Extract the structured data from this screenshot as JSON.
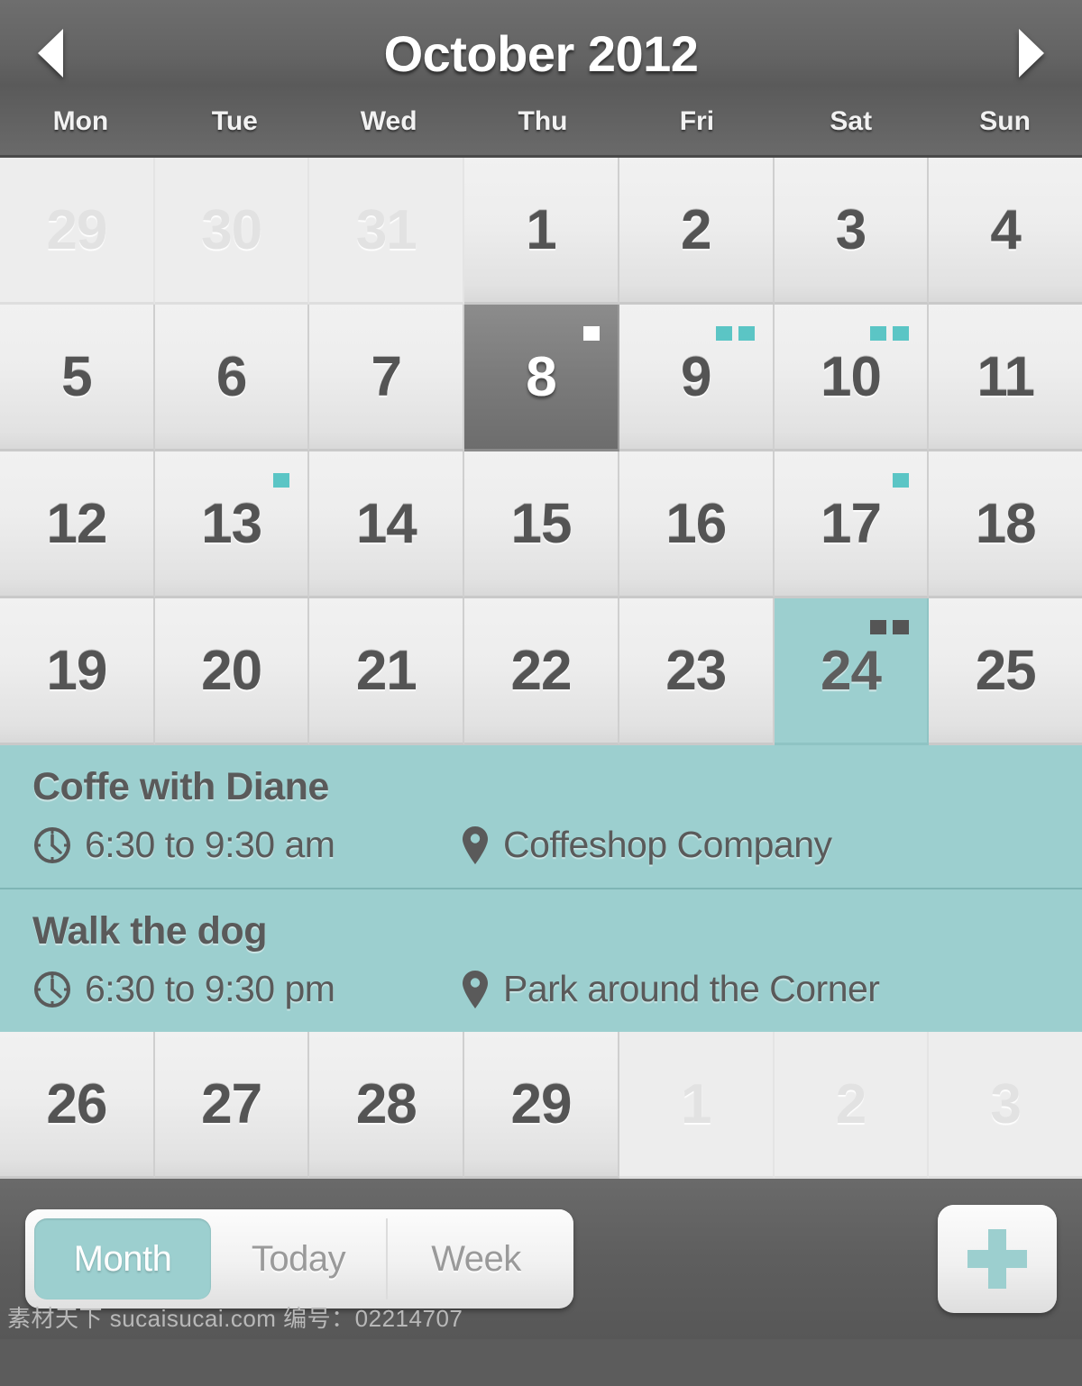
{
  "header": {
    "title": "October 2012",
    "prev_icon": "triangle-left-icon",
    "next_icon": "triangle-right-icon",
    "weekdays": [
      "Mon",
      "Tue",
      "Wed",
      "Thu",
      "Fri",
      "Sat",
      "Sun"
    ]
  },
  "colors": {
    "accent_teal": "#9ccfcf",
    "dot_teal": "#5bc5c5",
    "today_gray": "#7b7b7b",
    "toolbar_gray": "#5e5e5e",
    "cell_light": "#ededed",
    "text_dark": "#545454"
  },
  "calendar": {
    "weeks": [
      [
        {
          "day": "29",
          "outside": true,
          "today": false,
          "selected": false,
          "dots": 0
        },
        {
          "day": "30",
          "outside": true,
          "today": false,
          "selected": false,
          "dots": 0
        },
        {
          "day": "31",
          "outside": true,
          "today": false,
          "selected": false,
          "dots": 0
        },
        {
          "day": "1",
          "outside": false,
          "today": false,
          "selected": false,
          "dots": 0
        },
        {
          "day": "2",
          "outside": false,
          "today": false,
          "selected": false,
          "dots": 0
        },
        {
          "day": "3",
          "outside": false,
          "today": false,
          "selected": false,
          "dots": 0
        },
        {
          "day": "4",
          "outside": false,
          "today": false,
          "selected": false,
          "dots": 0
        }
      ],
      [
        {
          "day": "5",
          "outside": false,
          "today": false,
          "selected": false,
          "dots": 0
        },
        {
          "day": "6",
          "outside": false,
          "today": false,
          "selected": false,
          "dots": 0
        },
        {
          "day": "7",
          "outside": false,
          "today": false,
          "selected": false,
          "dots": 0
        },
        {
          "day": "8",
          "outside": false,
          "today": true,
          "selected": false,
          "dots": 1
        },
        {
          "day": "9",
          "outside": false,
          "today": false,
          "selected": false,
          "dots": 2
        },
        {
          "day": "10",
          "outside": false,
          "today": false,
          "selected": false,
          "dots": 2
        },
        {
          "day": "11",
          "outside": false,
          "today": false,
          "selected": false,
          "dots": 0
        }
      ],
      [
        {
          "day": "12",
          "outside": false,
          "today": false,
          "selected": false,
          "dots": 0
        },
        {
          "day": "13",
          "outside": false,
          "today": false,
          "selected": false,
          "dots": 1
        },
        {
          "day": "14",
          "outside": false,
          "today": false,
          "selected": false,
          "dots": 0
        },
        {
          "day": "15",
          "outside": false,
          "today": false,
          "selected": false,
          "dots": 0
        },
        {
          "day": "16",
          "outside": false,
          "today": false,
          "selected": false,
          "dots": 0
        },
        {
          "day": "17",
          "outside": false,
          "today": false,
          "selected": false,
          "dots": 1
        },
        {
          "day": "18",
          "outside": false,
          "today": false,
          "selected": false,
          "dots": 0
        }
      ],
      [
        {
          "day": "19",
          "outside": false,
          "today": false,
          "selected": false,
          "dots": 0
        },
        {
          "day": "20",
          "outside": false,
          "today": false,
          "selected": false,
          "dots": 0
        },
        {
          "day": "21",
          "outside": false,
          "today": false,
          "selected": false,
          "dots": 0
        },
        {
          "day": "22",
          "outside": false,
          "today": false,
          "selected": false,
          "dots": 0
        },
        {
          "day": "23",
          "outside": false,
          "today": false,
          "selected": false,
          "dots": 0
        },
        {
          "day": "24",
          "outside": false,
          "today": false,
          "selected": true,
          "dots": 2
        },
        {
          "day": "25",
          "outside": false,
          "today": false,
          "selected": false,
          "dots": 0
        }
      ],
      [
        {
          "day": "26",
          "outside": false,
          "today": false,
          "selected": false,
          "dots": 0
        },
        {
          "day": "27",
          "outside": false,
          "today": false,
          "selected": false,
          "dots": 0
        },
        {
          "day": "28",
          "outside": false,
          "today": false,
          "selected": false,
          "dots": 0
        },
        {
          "day": "29",
          "outside": false,
          "today": false,
          "selected": false,
          "dots": 0
        },
        {
          "day": "1",
          "outside": true,
          "today": false,
          "selected": false,
          "dots": 0
        },
        {
          "day": "2",
          "outside": true,
          "today": false,
          "selected": false,
          "dots": 0
        },
        {
          "day": "3",
          "outside": true,
          "today": false,
          "selected": false,
          "dots": 0
        }
      ]
    ]
  },
  "events": [
    {
      "title": "Coffe with Diane",
      "time": "6:30 to 9:30 am",
      "location": "Coffeshop Company",
      "time_icon": "clock-icon",
      "location_icon": "map-pin-icon"
    },
    {
      "title": "Walk the dog",
      "time": "6:30 to 9:30 pm",
      "location": "Park around the Corner",
      "time_icon": "clock-icon",
      "location_icon": "map-pin-icon"
    }
  ],
  "toolbar": {
    "segments": [
      {
        "label": "Month",
        "active": true
      },
      {
        "label": "Today",
        "active": false
      },
      {
        "label": "Week",
        "active": false
      }
    ],
    "add_icon": "plus-icon"
  },
  "watermark": "素材天下 sucaisucai.com  编号：02214707"
}
